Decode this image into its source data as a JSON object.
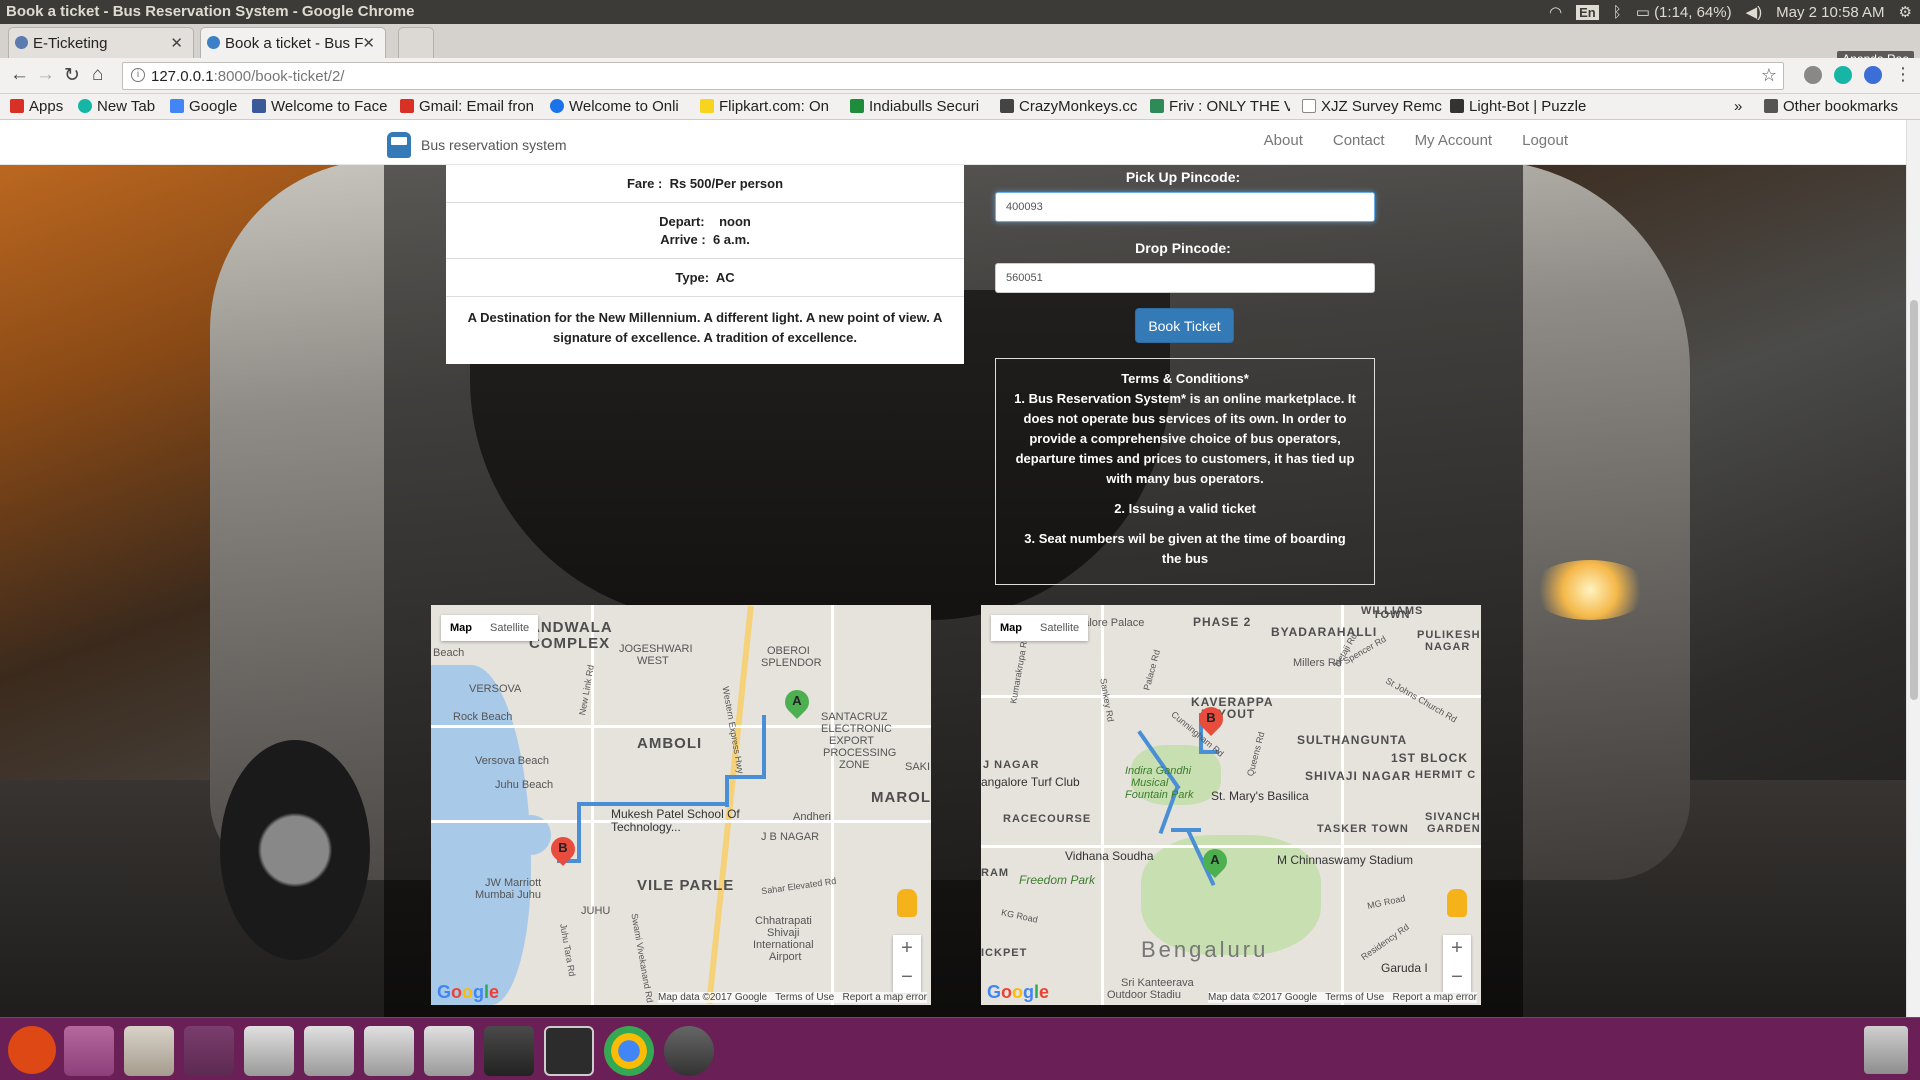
{
  "os": {
    "window_title": "Book a ticket - Bus Reservation System - Google Chrome",
    "language_indicator": "En",
    "battery": "(1:14, 64%)",
    "datetime": "May 2 10:58 AM"
  },
  "browser": {
    "tabs": [
      {
        "title": "E-Ticketing"
      },
      {
        "title": "Book a ticket - Bus F"
      }
    ],
    "profile_name": "Ananda Rao",
    "url_host": "127.0.0.1",
    "url_path": ":8000/book-ticket/2/",
    "bookmarks": [
      {
        "label": "Apps",
        "icon": "apps-grid-icon",
        "color": "#d93025"
      },
      {
        "label": "New Tab",
        "icon": "newtab-icon",
        "color": "#16b6a6"
      },
      {
        "label": "Google",
        "icon": "google-icon",
        "color": "#4285f4"
      },
      {
        "label": "Welcome to Face",
        "icon": "facebook-icon",
        "color": "#3b5998"
      },
      {
        "label": "Gmail: Email fron",
        "icon": "gmail-icon",
        "color": "#d93025"
      },
      {
        "label": "Welcome to Onli",
        "icon": "globe-icon",
        "color": "#1a73e8"
      },
      {
        "label": "Flipkart.com: On",
        "icon": "flipkart-icon",
        "color": "#f8d41f"
      },
      {
        "label": "Indiabulls Securi",
        "icon": "indiabulls-icon",
        "color": "#1e8c3a"
      },
      {
        "label": "CrazyMonkeys.cc",
        "icon": "monkey-icon",
        "color": "#444444"
      },
      {
        "label": "Friv : ONLY THE V",
        "icon": "friv-icon",
        "color": "#2e8b57"
      },
      {
        "label": "XJZ Survey Remc",
        "icon": "page-icon",
        "color": "#888888"
      },
      {
        "label": "Light-Bot | Puzzle",
        "icon": "lightbot-icon",
        "color": "#333333"
      }
    ],
    "other_bookmarks": "Other bookmarks",
    "more_bookmarks": "»"
  },
  "site": {
    "brand": "Bus reservation system",
    "nav": [
      "About",
      "Contact",
      "My Account",
      "Logout"
    ]
  },
  "ticket": {
    "fare_label": "Fare :",
    "fare_value": "Rs 500/Per person",
    "depart_label": "Depart:",
    "depart_value": "noon",
    "arrive_label": "Arrive :",
    "arrive_value": "6 a.m.",
    "type_label": "Type:",
    "type_value": "AC",
    "description": "A Destination for the New Millennium. A different light. A new point of view. A signature of excellence. A tradition of excellence."
  },
  "form": {
    "pickup_label": "Pick Up Pincode:",
    "pickup_value": "400093",
    "drop_label": "Drop Pincode:",
    "drop_value": "560051",
    "submit_label": "Book Ticket"
  },
  "terms": {
    "title": "Terms & Conditions*",
    "items": [
      "1. Bus Reservation System* is an online marketplace. It does not operate bus services of its own. In order to provide a comprehensive choice of bus operators, departure times and prices to customers, it has tied up with many bus operators.",
      "2. Issuing a valid ticket",
      "3. Seat numbers wil be given at the time of boarding the bus"
    ]
  },
  "maps": {
    "type_map": "Map",
    "type_satellite": "Satellite",
    "zoom_in": "+",
    "zoom_out": "−",
    "attribution": "Map data ©2017 Google",
    "terms": "Terms of Use",
    "report": "Report a map error",
    "marker_a": "A",
    "marker_b": "B",
    "marker_a_color": "#4caf50",
    "marker_b_color": "#e74c3c",
    "mumbai_labels": [
      "ANDWALA",
      "COMPLEX",
      "Beach",
      "JOGESHWARI",
      "WEST",
      "OBEROI",
      "SPLENDOR",
      "VERSOVA",
      "Rock Beach",
      "SANTACRUZ",
      "ELECTRONIC",
      "EXPORT",
      "PROCESSING",
      "ZONE",
      "SAKI",
      "AMBOLI",
      "Versova Beach",
      "Juhu Beach",
      "MAROL",
      "Mukesh Patel School Of",
      "Technology...",
      "Andheri",
      "J B NAGAR",
      "VILE PARLE",
      "JW Marriott",
      "Mumbai Juhu",
      "JUHU",
      "Sahar Elevated Rd",
      "Chhatrapati",
      "Shivaji",
      "International",
      "Airport",
      "Western Express Hwy",
      "New Link Rd",
      "Juhu Tara Rd",
      "Swami Vivekanand Rd"
    ],
    "bengaluru_labels": [
      "ngalore Palace",
      "PHASE 2",
      "BYADARAHALLI",
      "WILLIAMS",
      "TOWN",
      "PULIKESHI",
      "NAGAR",
      "Millers Rd",
      "KAVERAPPA",
      "LAYOUT",
      "SULTHANGUNTA",
      "1ST BLOCK",
      "HERMIT C",
      "J NAGAR",
      "angalore Turf Club",
      "Indira Gandhi",
      "Musical",
      "Fountain Park",
      "SHIVAJI NAGAR",
      "St. Mary's Basilica",
      "RACECOURSE",
      "TASKER TOWN",
      "SIVANCHET",
      "GARDENS",
      "Vidhana Soudha",
      "M Chinnaswamy Stadium",
      "RAM",
      "Freedom Park",
      "MG Road",
      "KG Road",
      "Bengaluru",
      "Garuda I",
      "ICKPET",
      "Sri Kanteerava",
      "Outdoor Stadiu",
      "Palace Rd",
      "Cunningham Rd",
      "Queens Rd",
      "Residency Rd",
      "Sankey Rd",
      "Kumarakrupa Rd",
      "Netaji Rd",
      "Spencer Rd",
      "St Johns Church Rd"
    ]
  },
  "colors": {
    "primary": "#337ab7",
    "taskbar": "#6b1f57",
    "route": "#4a8ed6"
  }
}
